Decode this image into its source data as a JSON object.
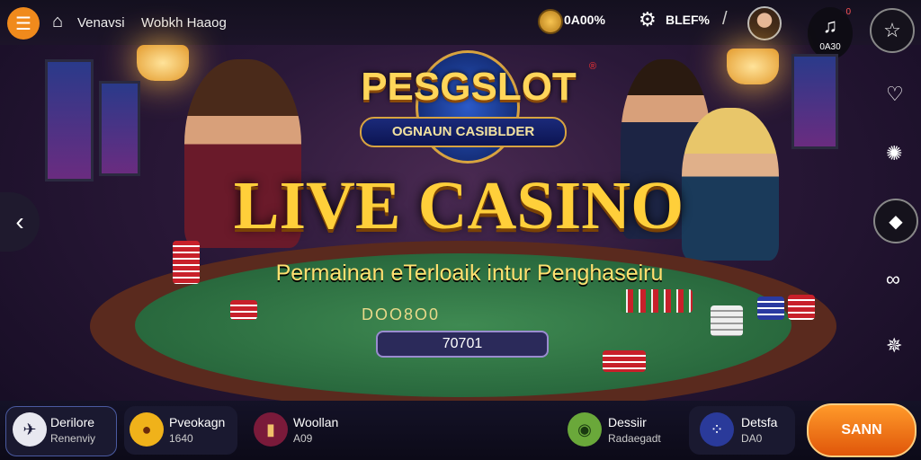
{
  "topbar": {
    "menu_icon": "hamburger-icon",
    "brand_icon": "brand-logo-icon",
    "brand_text": "Venavsi",
    "nav_link": "Wobkh Haaog",
    "coin_value": "0A00%",
    "gear_value": "BLEF%",
    "notif_count": "0A30",
    "notif_dot": "0"
  },
  "hero": {
    "logo": "PESGSLOT",
    "logo_reg": "®",
    "logo_sub": "OGNAUN CASIBLDER",
    "title": "LIVE CASINO",
    "subtitle": "Permainan eTerloaik intur Penghaseiru",
    "felt_label": "DOO8O0",
    "pot_value": "70701"
  },
  "bottom": {
    "items": [
      {
        "label": "Derilore",
        "sub": "Renenviy",
        "icon": "share-icon"
      },
      {
        "label": "Pveokagn",
        "sub": "1640",
        "icon": "chat-bubble-icon"
      },
      {
        "label": "Woollan",
        "sub": "A09",
        "icon": "wallet-icon"
      },
      {
        "label": "Dessiir",
        "sub": "Radaegadt",
        "icon": "chip-icon"
      },
      {
        "label": "Detsfa",
        "sub": "DA0",
        "icon": "dots-icon"
      }
    ],
    "cta": "SANN"
  },
  "colors": {
    "accent": "#f08a1c",
    "gold": "#ffcf3a",
    "felt": "#2f7a45"
  }
}
